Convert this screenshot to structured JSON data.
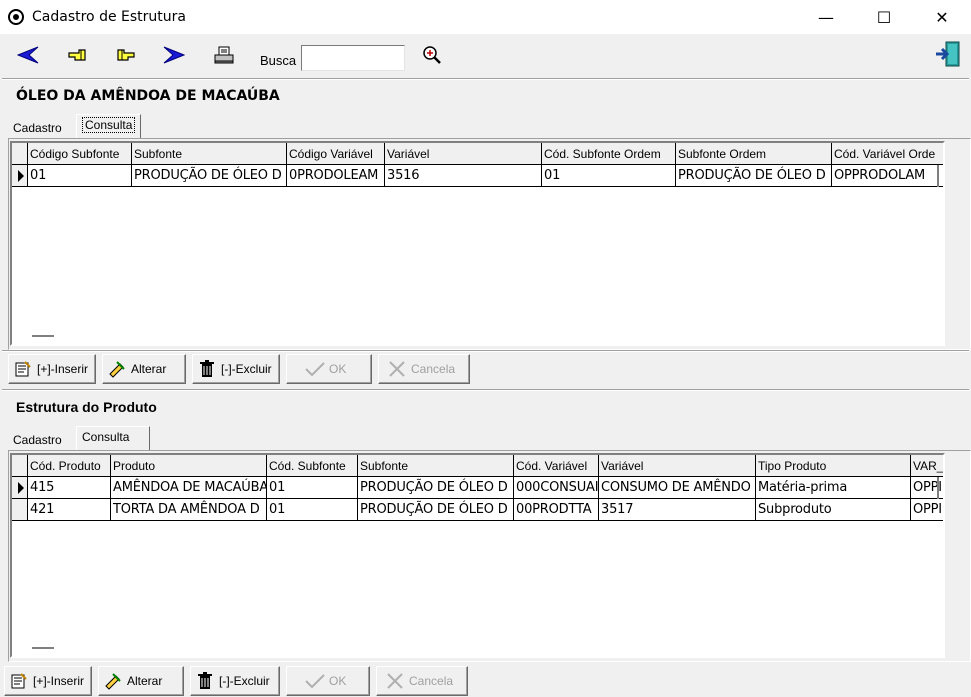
{
  "window": {
    "title": "Cadastro de Estrutura",
    "minimize": "—",
    "maximize": "☐",
    "close": "✕"
  },
  "toolbar": {
    "search_label": "Busca",
    "search_value": ""
  },
  "section1": {
    "title": "ÓLEO DA AMÊNDOA DE MACAÚBA",
    "tabs": [
      "Cadastro",
      "Consulta"
    ],
    "columns": [
      "Código Subfonte",
      "Subfonte",
      "Código Variável",
      "Variável",
      "Cód. Subfonte Ordem",
      "Subfonte Ordem",
      "Cód. Variável Orde"
    ],
    "rows": [
      [
        "01",
        "PRODUÇÃO DE ÓLEO D",
        "0PRODOLEAM",
        "3516",
        "01",
        "PRODUÇÃO DE ÓLEO D",
        "OPPRODOLAM"
      ]
    ],
    "buttons": {
      "insert": "[+]-Inserir",
      "edit": "Alterar",
      "delete": "[-]-Excluir",
      "ok": "OK",
      "cancel": "Cancela"
    }
  },
  "section2": {
    "title": "Estrutura do Produto",
    "tabs": [
      "Cadastro",
      "Consulta"
    ],
    "columns": [
      "Cód. Produto",
      "Produto",
      "Cód. Subfonte",
      "Subfonte",
      "Cód. Variável",
      "Variável",
      "Tipo Produto",
      "VAR_"
    ],
    "rows": [
      [
        "415",
        "AMÊNDOA DE MACAÚBA",
        "01",
        "PRODUÇÃO DE ÓLEO D",
        "000CONSUAI",
        "CONSUMO DE AMÊNDO",
        "Matéria-prima",
        "OPPI"
      ],
      [
        "421",
        "TORTA DA AMÊNDOA D",
        "01",
        "PRODUÇÃO DE ÓLEO D",
        "00PRODTTA",
        "3517",
        "Subproduto",
        "OPPI"
      ]
    ],
    "buttons": {
      "insert": "[+]-Inserir",
      "edit": "Alterar",
      "delete": "[-]-Excluir",
      "ok": "OK",
      "cancel": "Cancela"
    }
  },
  "icons": {
    "app": "app-icon",
    "first": "arrow-left-icon",
    "prev": "hand-left-icon",
    "next": "hand-right-icon",
    "last": "arrow-right-icon",
    "print": "printer-icon",
    "search": "magnifier-icon",
    "exit": "exit-door-icon"
  }
}
